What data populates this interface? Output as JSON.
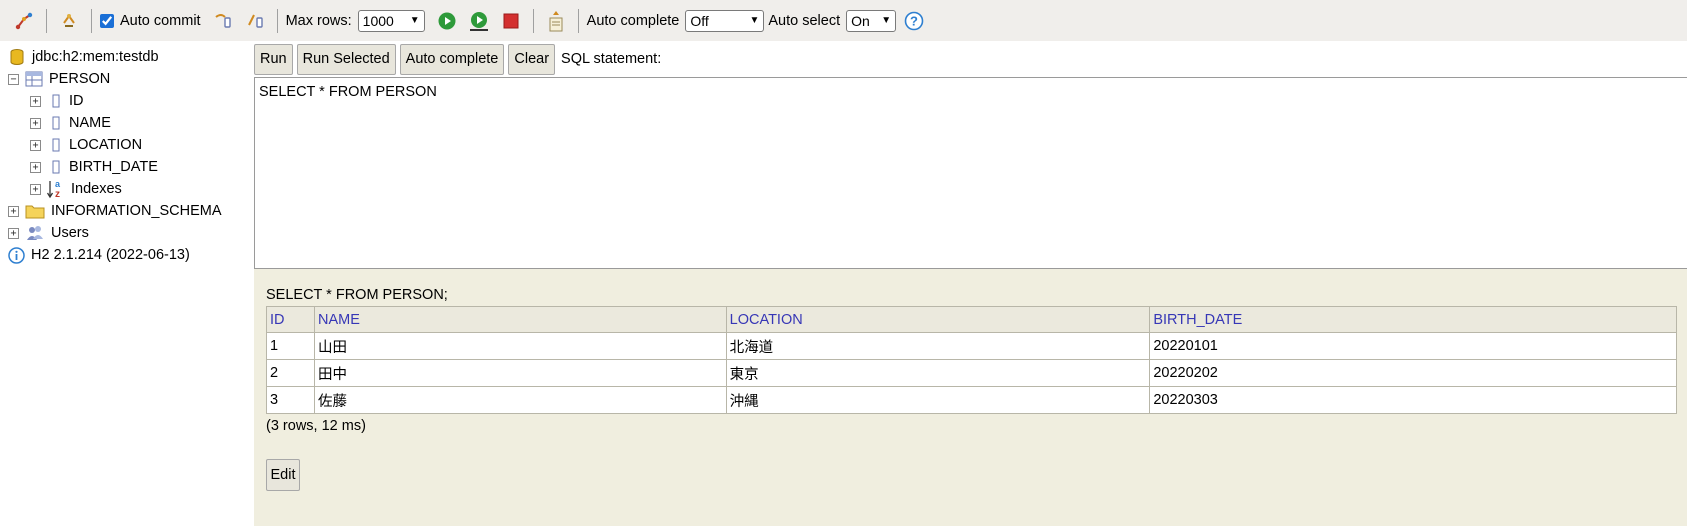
{
  "toolbar": {
    "auto_commit_label": "Auto commit",
    "auto_commit_checked": true,
    "max_rows_label": "Max rows:",
    "max_rows_value": "1000",
    "auto_complete_label": "Auto complete",
    "auto_complete_value": "Off",
    "auto_select_label": "Auto select",
    "auto_select_value": "On"
  },
  "tree": {
    "connection": "jdbc:h2:mem:testdb",
    "table_name": "PERSON",
    "columns": [
      "ID",
      "NAME",
      "LOCATION",
      "BIRTH_DATE"
    ],
    "indexes": "Indexes",
    "schema": "INFORMATION_SCHEMA",
    "users": "Users",
    "version": "H2 2.1.214 (2022-06-13)"
  },
  "buttons": {
    "run": "Run",
    "run_selected": "Run Selected",
    "auto_complete": "Auto complete",
    "clear": "Clear",
    "sql_statement_label": "SQL statement:"
  },
  "editor": {
    "text": "SELECT * FROM PERSON"
  },
  "results": {
    "sql": "SELECT * FROM PERSON;",
    "headers": [
      "ID",
      "NAME",
      "LOCATION",
      "BIRTH_DATE"
    ],
    "rows": [
      [
        "1",
        "山田",
        "北海道",
        "20220101"
      ],
      [
        "2",
        "田中",
        "東京",
        "20220202"
      ],
      [
        "3",
        "佐藤",
        "沖縄",
        "20220303"
      ]
    ],
    "meta": "(3 rows, 12 ms)",
    "edit_label": "Edit"
  },
  "colors": {
    "toolbar_bg": "#f0eeeb",
    "results_bg": "#f0eedf",
    "header_text": "#3737b6",
    "run_green": "#2e9a3a",
    "stop_red": "#d32f2f"
  }
}
